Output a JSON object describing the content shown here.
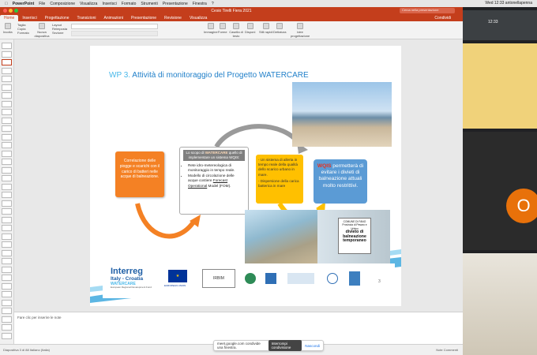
{
  "menubar": {
    "app": "PowerPoint",
    "items": [
      "File",
      "Composizione",
      "Visualizza",
      "Inserisci",
      "Formato",
      "Strumenti",
      "Presentazione",
      "Finestra",
      "?"
    ],
    "right": "Wed 12:33   antonellapenna"
  },
  "window": {
    "title": "Cesio Tirelli Fiera 2021",
    "search_placeholder": "Cerca nella presentazione"
  },
  "ribbon": {
    "tabs": [
      "Home",
      "Inserisci",
      "Progettazione",
      "Transizioni",
      "Animazioni",
      "Presentazione",
      "Revisione",
      "Visualizza"
    ],
    "active_tab": "Home",
    "share_label": "Condividi",
    "labels": [
      "Incolla",
      "Taglia",
      "Copia",
      "Formato",
      "Nuova diapositiva",
      "Layout",
      "Reimposta",
      "Sezione",
      "Immagine",
      "Forme",
      "Casella di testo",
      "Disponi",
      "Stili rapidi",
      "Dettatura",
      "Idee progettazione"
    ]
  },
  "slide": {
    "title_wp": "WP 3.",
    "title_rest": " Attività di monitoraggio del Progetto WATERCARE",
    "orange_box": "Correlazione delle piogge e scarichi con il carico di batteri nelle acque di balneazione.",
    "mid_box": {
      "head_prefix": "Lo scopo di ",
      "head_brand": "WATERCARE",
      "head_rest": " quello di implementare un sistema WQIS:",
      "bullet1": "Rete idro-metereologica di monitoraggio in tempo reale.",
      "bullet2_pre": "Modello di circolazione delle acque costiere ",
      "bullet2_u": "Forecast Operational",
      "bullet2_post": " Model (FOM)."
    },
    "yellow_box": {
      "line1": "- Un sistema di allerta in tempo reale della qualità dello scarico urbano in mare.",
      "line2": "- Dispersione della carica batterica in mare"
    },
    "blue_box": {
      "brand": "WQIS",
      "text": " permetterà di evitare i divieti di balneazione attuali molto restrittivi."
    },
    "sign": {
      "top": "COMUNE DI FANO",
      "mid": "Provincia di Pesaro e Urbino",
      "big": "divieto di balneazione temporaneo"
    },
    "logos": {
      "interreg": "Interreg",
      "italy_croatia": "Italy - Croatia",
      "watercare": "WATERCARE",
      "efrd": "European Regional Development Fund",
      "eu": "EUROPEAN UNION",
      "irbim": "IRBIM",
      "page": "3"
    }
  },
  "notes": {
    "placeholder": "Fare clic per inserire le note"
  },
  "status": {
    "left": "Diapositiva 3 di 88   Italiano (Italia)",
    "right": "Note   Commenti"
  },
  "meet": {
    "share_text": "meet.google.com condivide una finestra.",
    "stop_button": "Interrompi condivisione",
    "hide_button": "Nascondi",
    "time1": "12:33",
    "participant_initial": "O"
  },
  "colors": {
    "accent": "#c43e1c",
    "orange": "#f48124",
    "yellow": "#ffc000",
    "blue": "#5b9bd5",
    "title_blue": "#1f7fc9"
  }
}
